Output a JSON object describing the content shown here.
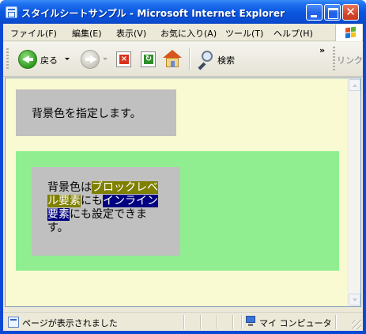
{
  "window": {
    "title": "スタイルシートサンプル - Microsoft Internet Explorer"
  },
  "menu": {
    "items": [
      "ファイル(F)",
      "編集(E)",
      "表示(V)",
      "お気に入り(A)",
      "ツール(T)",
      "ヘルプ(H)"
    ]
  },
  "toolbar": {
    "back_label": "戻る",
    "search_label": "検索",
    "links_label": "リンク",
    "overflow": "»"
  },
  "page": {
    "box1_text": "背景色を指定します。",
    "para": {
      "part1": "背景色は",
      "hl_block": "ブロックレベル要素",
      "part2": "にも",
      "hl_inline": "インライン要素",
      "part3": "にも設定できます。"
    }
  },
  "status": {
    "text": "ページが表示されました",
    "zone": "マイ コンピュータ"
  },
  "colors": {
    "page_bg": "#fafad2",
    "gray_box": "#c0c0c0",
    "green_box": "#90ee90",
    "olive_highlight": "#808000",
    "navy_highlight": "#000080",
    "titlebar": "#0a58e0"
  }
}
